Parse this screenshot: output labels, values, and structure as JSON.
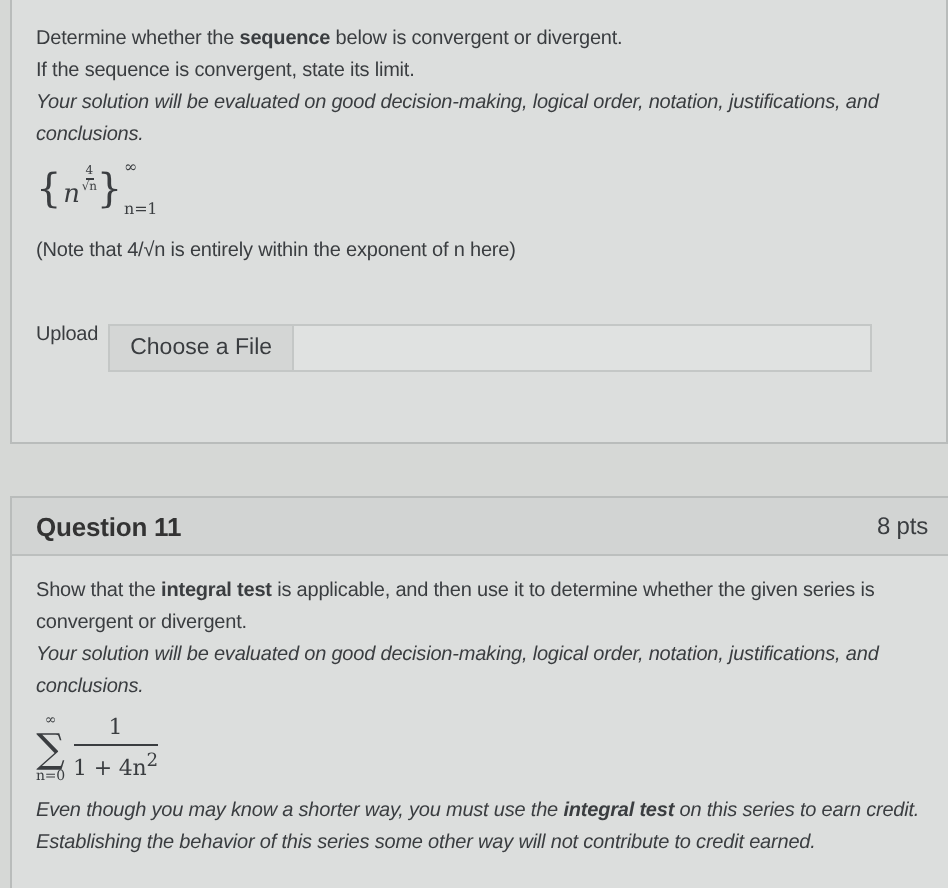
{
  "question_10": {
    "paragraphs": [
      {
        "kind": "plain",
        "text": "Determine whether the **sequence** below is convergent or divergent."
      },
      {
        "kind": "plain",
        "text": "If the sequence is convergent, state its limit."
      },
      {
        "kind": "italic",
        "text": "Your solution will be evaluated on good decision-making, logical order, notation, justifications, and conclusions."
      }
    ],
    "formula": {
      "open": "{",
      "base": "n",
      "exp_num": "4",
      "exp_den": "√n",
      "close": "}",
      "upper": "∞",
      "lower": "n=1"
    },
    "note": "(Note that 4/√n is entirely within the exponent of n here)",
    "upload": {
      "label": "Upload",
      "button": "Choose a File"
    }
  },
  "question_11": {
    "title": "Question 11",
    "points": "8 pts",
    "paragraphs": [
      {
        "kind": "plain",
        "text": "Show that the **integral test** is applicable, and then use it to determine whether the given series is convergent or divergent."
      },
      {
        "kind": "italic",
        "text": "Your solution will be evaluated on good decision-making, logical order, notation, justifications, and conclusions."
      }
    ],
    "formula": {
      "sigma": "∑",
      "upper": "∞",
      "lower": "n=0",
      "numerator": "1",
      "denominator": "1 + 4n$^{2}$"
    },
    "footer": [
      {
        "kind": "italic",
        "text": "Even though you may know a shorter way, you must use the **integral test** on this series to earn credit."
      },
      {
        "kind": "italic",
        "text": "Establishing the behavior of this series some other way will not contribute to credit earned."
      }
    ]
  }
}
